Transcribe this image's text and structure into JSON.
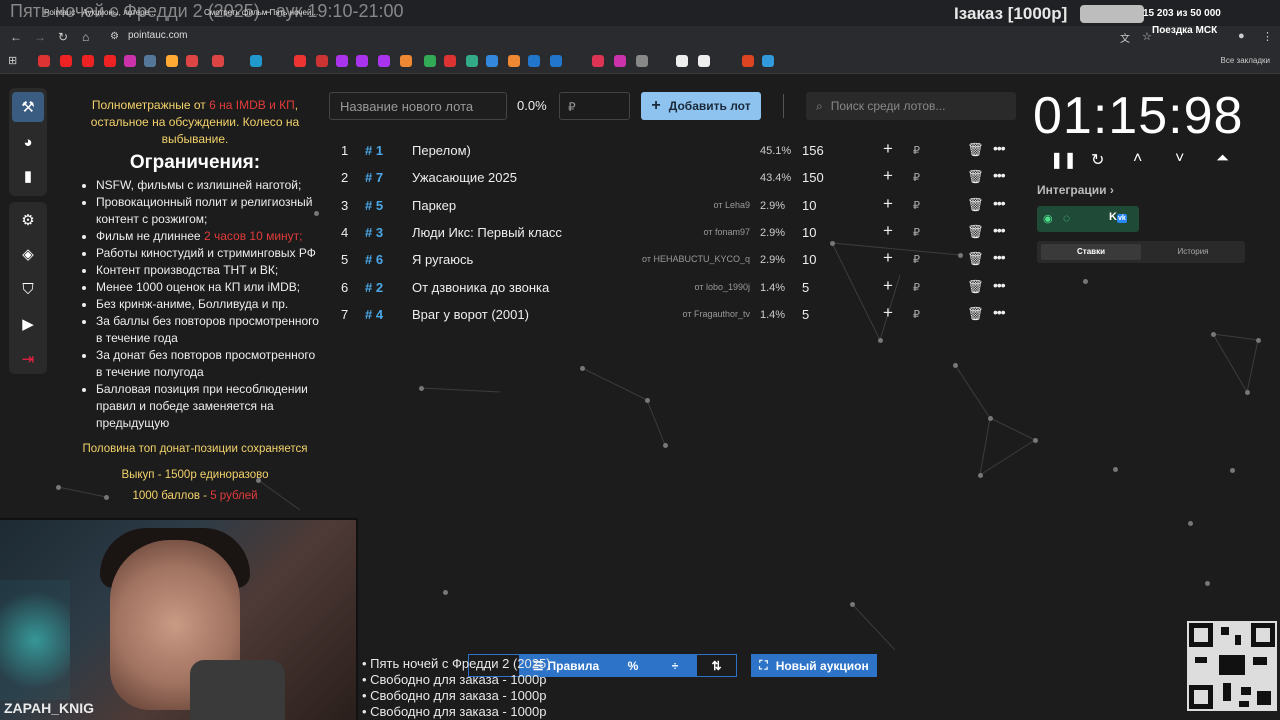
{
  "overlay": {
    "title": "Пять ночей с Фредди 2 (2025) - аук 19:10-21:00",
    "order": "Iзаказ [1000р]",
    "count": "15 203  из 50 000",
    "trip": "Поездка МСК"
  },
  "browser": {
    "tabs": [
      "Pointauc - Аукционы, лотере...",
      "Смотреть фильм Пять ночей..."
    ],
    "url": "pointauc.com",
    "all_bookmarks": "Все закладки"
  },
  "rules": {
    "intro_a": "Полнометражные от ",
    "intro_red": "6 на IMDB и КП",
    "intro_b": ", остальное на обсуждении. Колесо на выбывание.",
    "heading": "Ограничения:",
    "items": [
      "NSFW, фильмы с излишней наготой;",
      "Провокационный полит и религиозный контент с розжигом;",
      "Фильм не длиннее ",
      "Работы киностудий и стриминговых РФ",
      "Контент производства ТНТ и ВК;",
      "Менее 1000 оценок на КП или iMDB;",
      "Без кринж-аниме, Болливуда и пр.",
      "За баллы без повторов просмотренного в течение года",
      "За донат без повторов просмотренного в течение полугода",
      "Балловая позиция при несоблюдении правил и победе заменяется на предыдущую"
    ],
    "length_red": "2 часов 10 минут;",
    "foot1": "Половина топ донат-позиции сохраняется",
    "foot2": "Выкуп - 1500р единоразово",
    "foot3_a": "1000 баллов - ",
    "foot3_red": "5 рублей"
  },
  "controls": {
    "lot_placeholder": "Название нового лота",
    "percent": "0.0%",
    "rub_placeholder": "₽",
    "add_label": "Добавить лот",
    "search_placeholder": "Поиск среди лотов..."
  },
  "lots": [
    {
      "num": "1",
      "id": "# 1",
      "title": "Перелом)",
      "from": "",
      "pct": "45.1%",
      "amount": "156"
    },
    {
      "num": "2",
      "id": "# 7",
      "title": "Ужасающие 2025",
      "from": "",
      "pct": "43.4%",
      "amount": "150"
    },
    {
      "num": "3",
      "id": "# 5",
      "title": "Паркер",
      "from": "от Leha9",
      "pct": "2.9%",
      "amount": "10"
    },
    {
      "num": "4",
      "id": "# 3",
      "title": "Люди Икс: Первый класс",
      "from": "от fonam97",
      "pct": "2.9%",
      "amount": "10"
    },
    {
      "num": "5",
      "id": "# 6",
      "title": "Я ругаюсь",
      "from": "от HEHABUCTU_KYCO_q",
      "pct": "2.9%",
      "amount": "10"
    },
    {
      "num": "6",
      "id": "# 2",
      "title": "От дзвоника до звонка",
      "from": "от lobo_1990j",
      "pct": "1.4%",
      "amount": "5"
    },
    {
      "num": "7",
      "id": "# 4",
      "title": "Враг у ворот (2001)",
      "from": "от Fragauthor_tv",
      "pct": "1.4%",
      "amount": "5"
    }
  ],
  "timer": {
    "value": "01:15:98",
    "integrations": "Интеграции",
    "tab_bets": "Ставки",
    "tab_history": "История"
  },
  "webcam": {
    "name": "ZAPAH_KNIG"
  },
  "bottom": {
    "rules": "Правила",
    "new_auction": "Новый аукцион",
    "ticker": [
      "• Пять ночей с Фредди 2 (2025)",
      "• Свободно для заказа - 1000р",
      "• Свободно для заказа - 1000р",
      "• Свободно для заказа - 1000р"
    ]
  },
  "colors": {
    "accent": "#8ec3ef",
    "lot_id": "#4aa8e8",
    "warning": "#e23b3b",
    "highlight": "#f3d26b"
  }
}
